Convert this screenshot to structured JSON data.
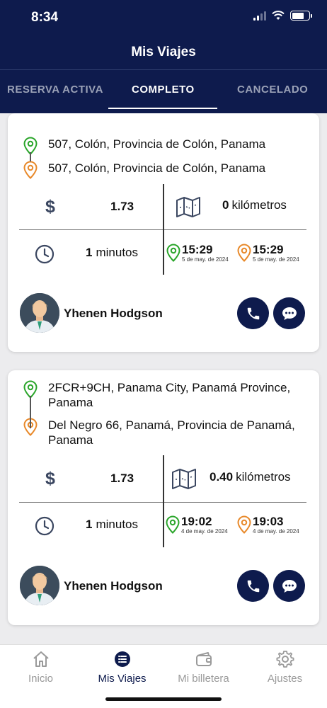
{
  "status_bar": {
    "time": "8:34"
  },
  "header": {
    "title": "Mis Viajes"
  },
  "tabs": [
    {
      "label": "RESERVA ACTIVA",
      "active": false
    },
    {
      "label": "COMPLETO",
      "active": true
    },
    {
      "label": "CANCELADO",
      "active": false
    }
  ],
  "trips": [
    {
      "origin": "507, Colón, Provincia de Colón, Panama",
      "destination": "507, Colón, Provincia de Colón, Panama",
      "currency_symbol": "$",
      "price": "1.73",
      "distance_value": "0",
      "distance_unit": "kilómetros",
      "duration_value": "1",
      "duration_unit": "minutos",
      "start_time": "15:29",
      "start_date": "5 de may. de 2024",
      "end_time": "15:29",
      "end_date": "5 de may. de 2024",
      "driver_name": "Yhenen Hodgson"
    },
    {
      "origin": "2FCR+9CH, Panama City, Panamá Province, Panama",
      "destination": "Del Negro 66, Panamá, Provincia de Panamá, Panama",
      "currency_symbol": "$",
      "price": "1.73",
      "distance_value": "0.40",
      "distance_unit": "kilómetros",
      "duration_value": "1",
      "duration_unit": "minutos",
      "start_time": "19:02",
      "start_date": "4 de may. de 2024",
      "end_time": "19:03",
      "end_date": "4 de may. de 2024",
      "driver_name": "Yhenen Hodgson"
    }
  ],
  "bottom_nav": [
    {
      "label": "Inicio",
      "icon": "home-icon",
      "active": false
    },
    {
      "label": "Mis Viajes",
      "icon": "list-icon",
      "active": true
    },
    {
      "label": "Mi billetera",
      "icon": "wallet-icon",
      "active": false
    },
    {
      "label": "Ajustes",
      "icon": "gear-icon",
      "active": false
    }
  ],
  "colors": {
    "primary": "#0e1b4d",
    "origin_pin": "#2aa52a",
    "destination_pin": "#e8892a",
    "inactive": "#9a9a9a"
  }
}
